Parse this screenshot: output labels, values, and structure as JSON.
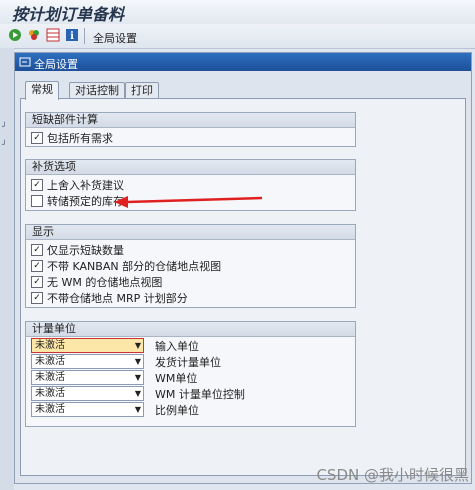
{
  "app": {
    "title": "按计划订单备料"
  },
  "toolbar": {
    "icons": [
      "execute-icon",
      "multi-color-icon",
      "layout-icon",
      "info-icon"
    ],
    "global_settings": "全局设置"
  },
  "dialog": {
    "title": "全局设置",
    "tabs": [
      {
        "label": "常规",
        "active": true
      },
      {
        "label": "对话控制",
        "active": false
      },
      {
        "label": "打印",
        "active": false
      }
    ],
    "groups": {
      "shortage": {
        "title": "短缺部件计算",
        "items": [
          {
            "label": "包括所有需求",
            "checked": true
          }
        ]
      },
      "replenishment": {
        "title": "补货选项",
        "items": [
          {
            "label": "上舍入补货建议",
            "checked": true
          },
          {
            "label": "转储预定的库存",
            "checked": false
          }
        ]
      },
      "display": {
        "title": "显示",
        "items": [
          {
            "label": "仅显示短缺数量",
            "checked": true
          },
          {
            "label": "不带 KANBAN 部分的仓储地点视图",
            "checked": true
          },
          {
            "label": "无 WM 的仓储地点视图",
            "checked": true
          },
          {
            "label": "不带仓储地点 MRP 计划部分",
            "checked": true
          }
        ]
      },
      "units": {
        "title": "计量单位",
        "rows": [
          {
            "value": "未激活",
            "label": "输入单位"
          },
          {
            "value": "未激活",
            "label": "发货计量单位"
          },
          {
            "value": "未激活",
            "label": "WM单位"
          },
          {
            "value": "未激活",
            "label": "WM 计量单位控制"
          },
          {
            "value": "未激活",
            "label": "比例单位"
          }
        ]
      }
    }
  },
  "colors": {
    "annotation": "#e02020",
    "titlebar": "#2a63b0"
  },
  "watermark": "CSDN @我小时候很黑"
}
